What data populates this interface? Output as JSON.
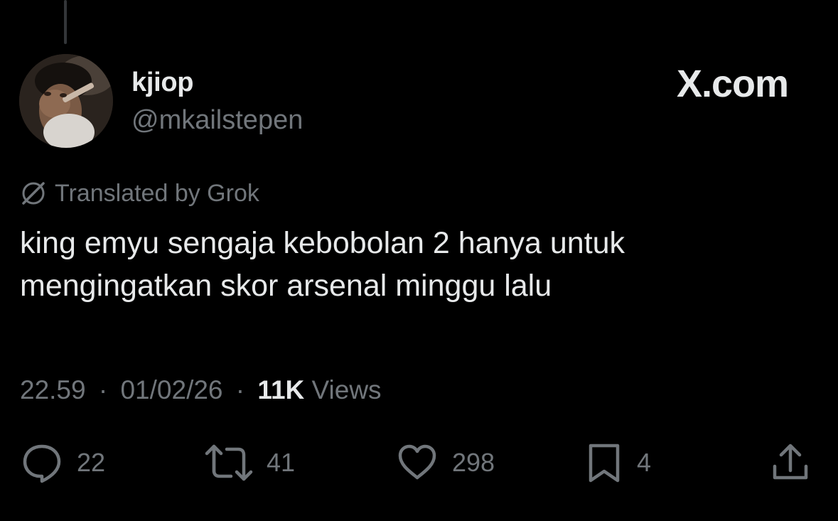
{
  "author": {
    "display_name": "kjiop",
    "handle": "@mkailstepen"
  },
  "brand": "X.com",
  "translation_label": "Translated by Grok",
  "tweet": {
    "lines": [
      "king emyu sengaja kebobolan 2 hanya untuk",
      "mengingatkan skor arsenal minggu lalu"
    ]
  },
  "meta": {
    "time": "22.59",
    "separator": "·",
    "date": "01/02/26",
    "views_count": "11K",
    "views_label": "Views"
  },
  "actions": {
    "reply": {
      "icon": "reply-icon",
      "count": "22"
    },
    "repost": {
      "icon": "repost-icon",
      "count": "41"
    },
    "like": {
      "icon": "heart-icon",
      "count": "298"
    },
    "bookmark": {
      "icon": "bookmark-icon",
      "count": "4"
    },
    "share": {
      "icon": "share-icon"
    }
  },
  "colors": {
    "background": "#000000",
    "primary_text": "#e7e9ea",
    "secondary_text": "#71767b"
  }
}
